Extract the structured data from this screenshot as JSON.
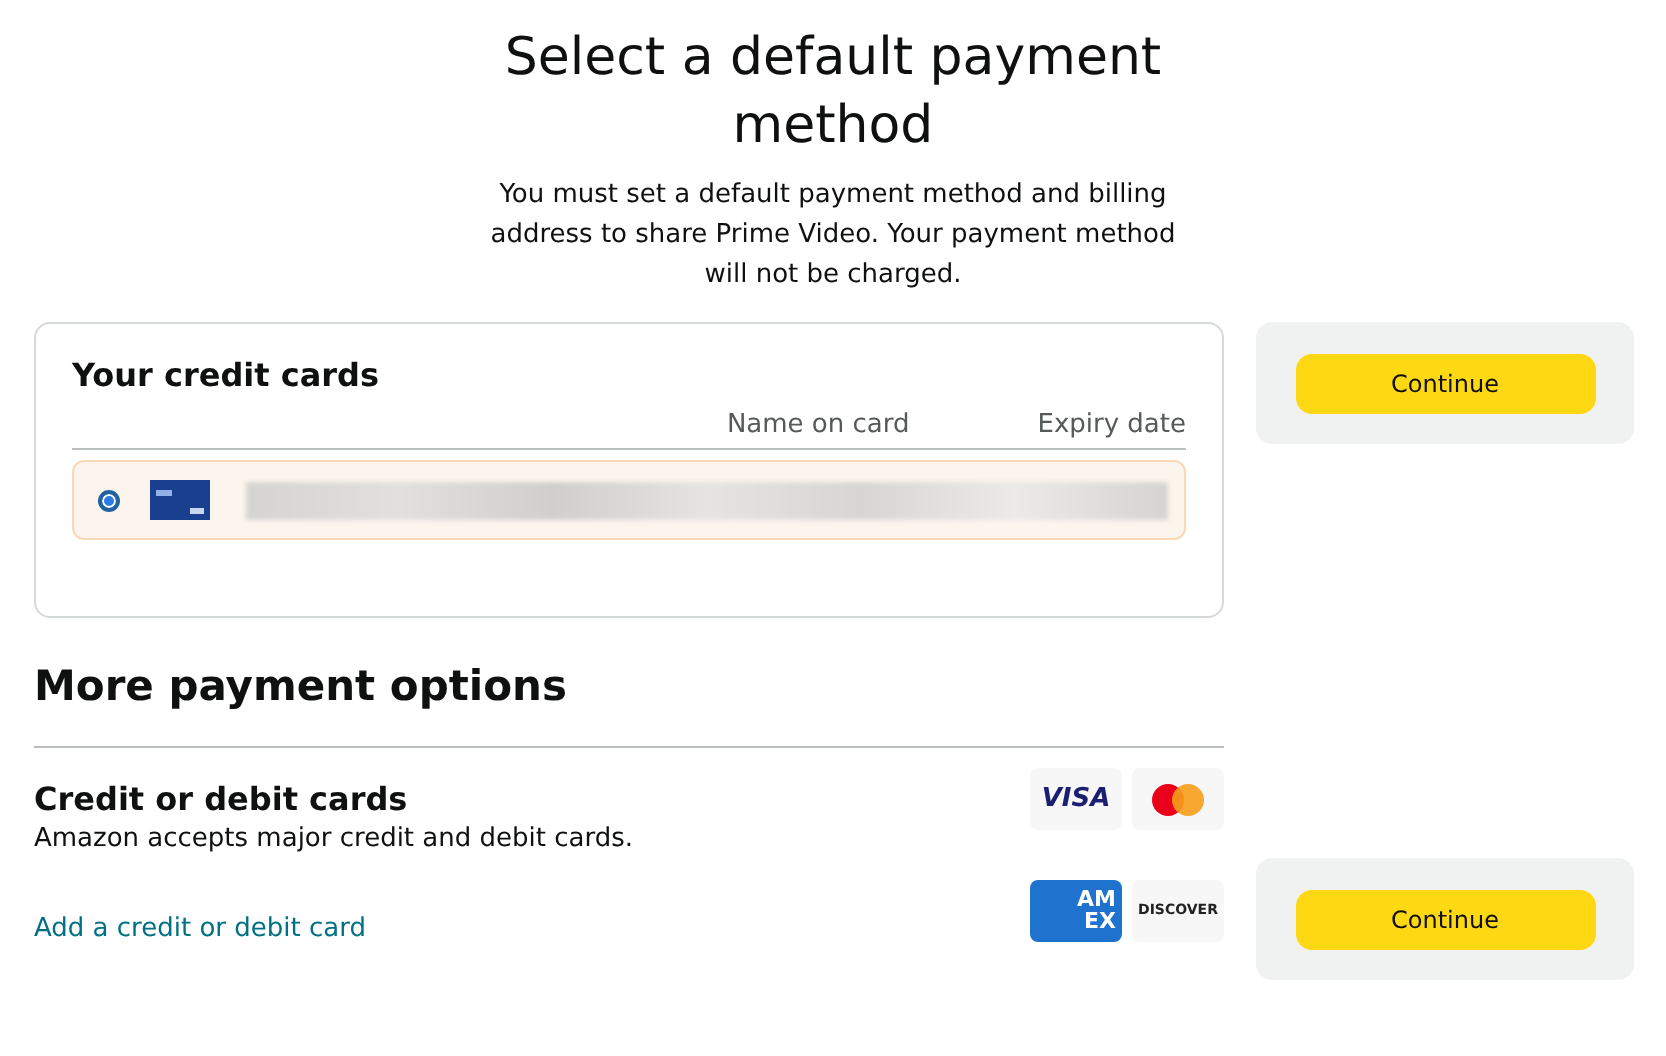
{
  "header": {
    "title": "Select a default payment method",
    "subtitle": "You must set a default payment method and billing address to share Prime Video. Your payment method will not be charged."
  },
  "credit_cards": {
    "title": "Your credit cards",
    "columns": [
      "Name on card",
      "Expiry date"
    ],
    "cards": [
      {
        "selected": true
      }
    ]
  },
  "more_options": {
    "title": "More payment options",
    "section_title": "Credit or debit cards",
    "description": "Amazon accepts major credit and debit cards.",
    "link": "Add a credit or debit card",
    "brands": [
      {
        "kind": "visa",
        "label": "VISA"
      },
      {
        "kind": "mastercard"
      },
      {
        "kind": "amex",
        "label_lines": [
          "AM",
          "EX"
        ]
      },
      {
        "kind": "discover",
        "label": "DISCOVER"
      }
    ]
  },
  "continue_buttons": [
    "Continue",
    "Continue"
  ]
}
